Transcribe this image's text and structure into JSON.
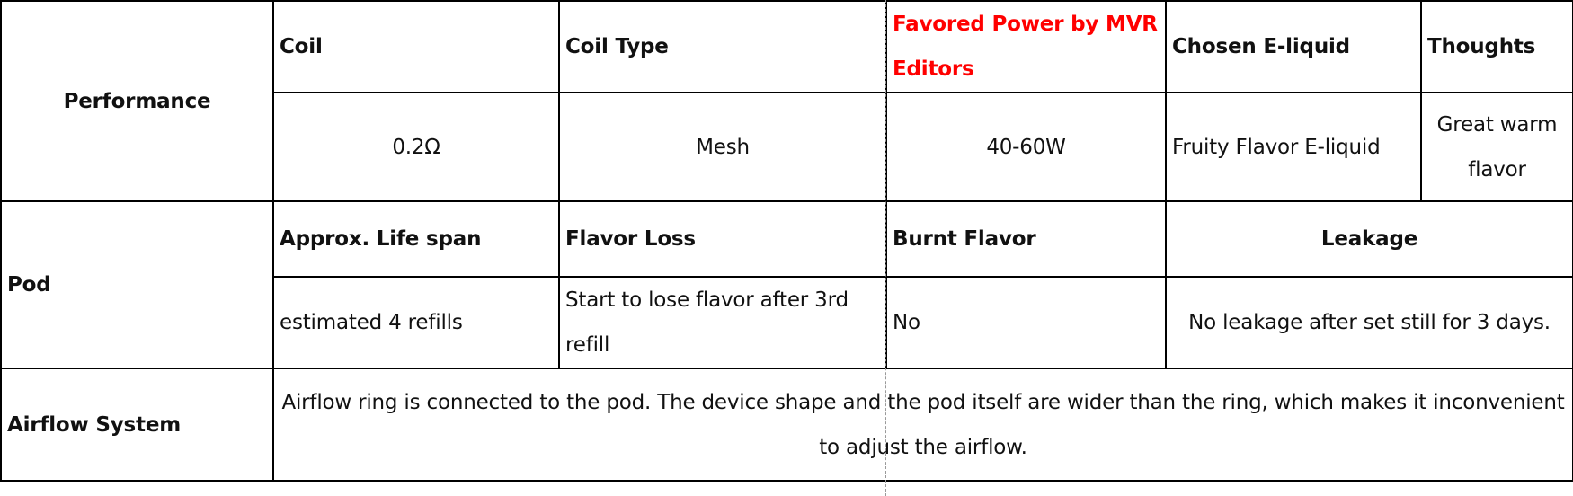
{
  "performance": {
    "label": "Performance",
    "headers": {
      "coil": "Coil",
      "coil_type": "Coil Type",
      "favored_power": "Favored Power by MVR Editors",
      "chosen_eliquid": "Chosen E-liquid",
      "thoughts": "Thoughts"
    },
    "values": {
      "coil": "0.2Ω",
      "coil_type": "Mesh",
      "favored_power": "40-60W",
      "chosen_eliquid": "Fruity Flavor E-liquid",
      "thoughts": "Great warm flavor"
    },
    "highlight_color": "#ff0000"
  },
  "pod": {
    "label": "Pod",
    "headers": {
      "life_span": "Approx. Life span",
      "flavor_loss": "Flavor Loss",
      "burnt_flavor": "Burnt Flavor",
      "leakage": "Leakage"
    },
    "values": {
      "life_span": "estimated 4 refills",
      "flavor_loss": "Start to lose flavor after 3rd refill",
      "burnt_flavor": "No",
      "leakage": "No leakage after set still for 3 days."
    }
  },
  "airflow": {
    "label": "Airflow System",
    "description": "Airflow ring is connected to the pod. The device shape and the pod itself are wider than the ring, which makes it inconvenient to adjust the airflow."
  }
}
